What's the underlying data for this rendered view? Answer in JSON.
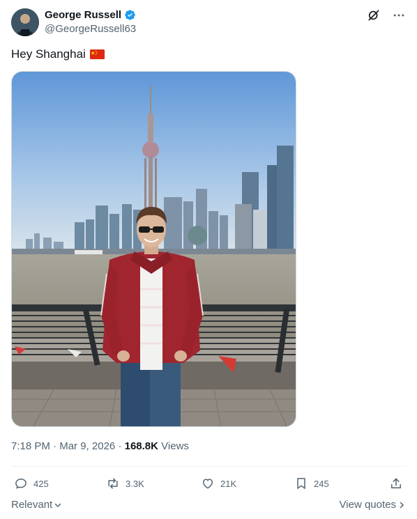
{
  "author": {
    "name": "George Russell",
    "handle": "@GeorgeRussell63",
    "verified_color": "#1d9bf0"
  },
  "header_icons": [
    "grok-icon",
    "more-icon"
  ],
  "tweet": {
    "text": "Hey Shanghai",
    "emoji": "china-flag-icon"
  },
  "meta": {
    "time": "7:18 PM",
    "separator": "·",
    "date": "Mar 9, 2026",
    "views_count": "168.8K",
    "views_label": "Views"
  },
  "actions": {
    "replies": "425",
    "reposts": "3.3K",
    "likes": "21K",
    "bookmarks": "245"
  },
  "footer": {
    "sort_label": "Relevant",
    "quotes_label": "View quotes"
  },
  "colors": {
    "text": "#0f1419",
    "secondary": "#536471",
    "accent": "#1d9bf0"
  }
}
